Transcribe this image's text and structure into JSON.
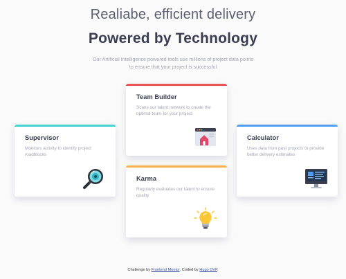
{
  "header": {
    "title_light": "Realiabe, efficient delivery",
    "title_bold": "Powered by Technology",
    "description": "Our Artificial Intelligence powered tools use millions of project data points to ensure that your project is successful"
  },
  "cards": {
    "supervisor": {
      "title": "Supervisor",
      "text": "Monitors activity to identify project roadblocks",
      "accent": "#44d3d2",
      "icon": "magnifier-icon"
    },
    "team_builder": {
      "title": "Team Builder",
      "text": "Scans our talent network to create the optimal team for your project",
      "accent": "#ea5454",
      "icon": "team-builder-window-icon"
    },
    "karma": {
      "title": "Karma",
      "text": "Regularly evaluates our talent to ensure quality",
      "accent": "#fcaf4a",
      "icon": "lightbulb-icon"
    },
    "calculator": {
      "title": "Calculator",
      "text": "Uses data from past projects to provide better delivery estimates",
      "accent": "#549ef2",
      "icon": "monitor-icon"
    }
  },
  "attribution": {
    "prefix": "Challenge by",
    "link1": "Frontend Mentor",
    "middle": ". Coded by",
    "link2": "Hugo DVP",
    "suffix": "."
  }
}
